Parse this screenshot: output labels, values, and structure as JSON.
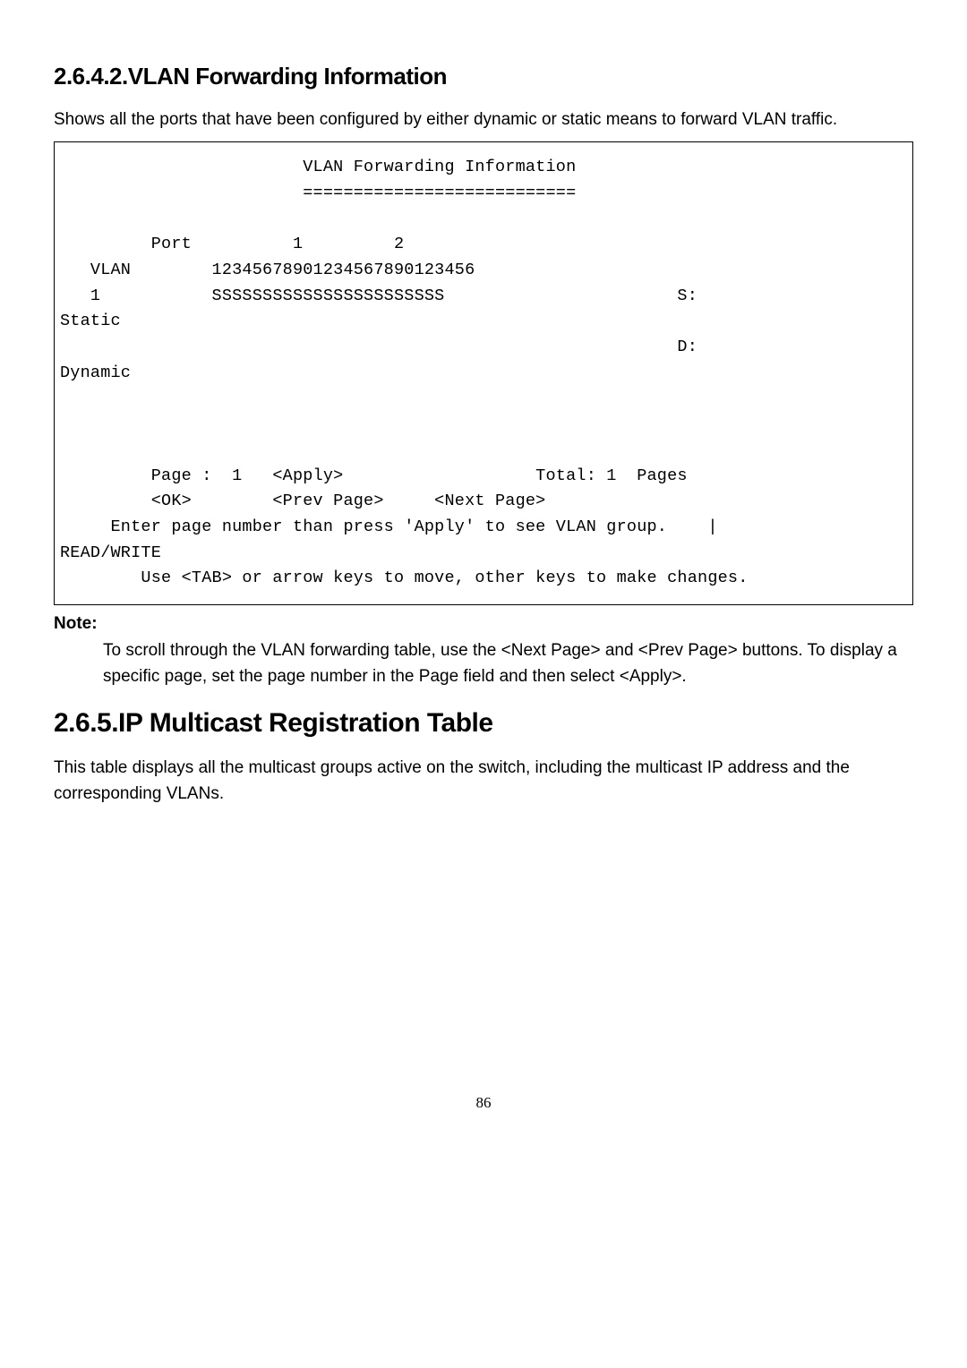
{
  "section1": {
    "heading": "2.6.4.2.VLAN Forwarding Information",
    "intro": "Shows all the ports that have been configured by either dynamic or static means to forward VLAN traffic."
  },
  "terminal": {
    "line01": "                        VLAN Forwarding Information",
    "line02": "                        ===========================",
    "line03": "",
    "line04": "         Port          1         2",
    "line05": "   VLAN        12345678901234567890123456",
    "line06": "   1           SSSSSSSSSSSSSSSSSSSSSSS                       S:",
    "line07": "Static",
    "line08": "                                                             D:",
    "line09": "Dynamic",
    "line10": "",
    "line11": "",
    "line12": "",
    "line13": "         Page :  1   <Apply>                   Total: 1  Pages",
    "line14": "         <OK>        <Prev Page>     <Next Page>",
    "line15": "     Enter page number than press 'Apply' to see VLAN group.    |",
    "line16": "READ/WRITE",
    "line17": "        Use <TAB> or arrow keys to move, other keys to make changes."
  },
  "note": {
    "label": "Note:",
    "body": "To scroll through the VLAN forwarding table, use the <Next Page> and <Prev Page> buttons. To display a specific page, set the page number in the Page field and then select <Apply>."
  },
  "section2": {
    "heading": "2.6.5.IP Multicast Registration Table",
    "intro": "This table displays all the multicast groups active on the switch, including the multicast IP address and the corresponding VLANs."
  },
  "page_number": "86"
}
